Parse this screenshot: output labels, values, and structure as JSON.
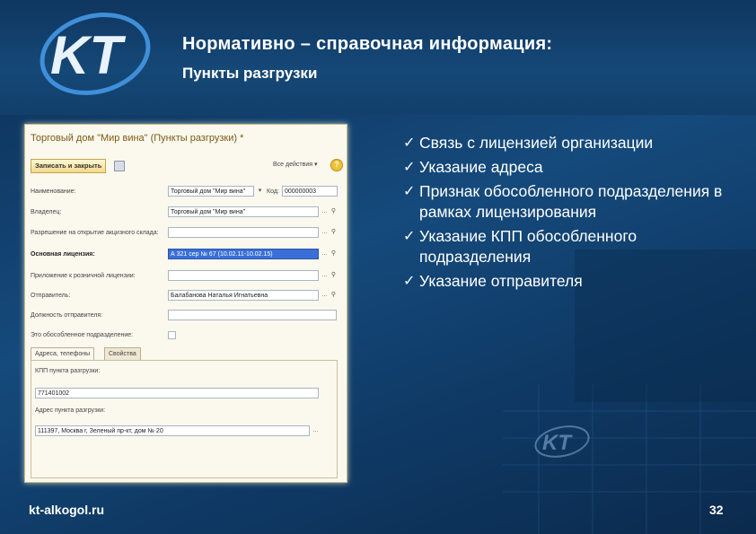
{
  "header": {
    "title": "Нормативно – справочная информация:",
    "subtitle": "Пункты разгрузки",
    "logo_text": "KT"
  },
  "form": {
    "window_title": "Торговый дом \"Мир вина\" (Пункты разгрузки) *",
    "save_button": "Записать и закрыть",
    "all_actions": "Все действия ▾",
    "help": "?",
    "fields": {
      "name_label": "Наименование:",
      "name_value": "Торговый дом \"Мир вина\"",
      "code_label": "Код:",
      "code_value": "000000003",
      "owner_label": "Владелец:",
      "owner_value": "Торговый дом \"Мир вина\"",
      "permit_label": "Разрешение на открытие акцизного склада:",
      "permit_value": "",
      "license_label": "Основная лицензия:",
      "license_value": "А 321 сер № 67 (10.02.11-10.02.15)",
      "retail_label": "Приложение к розничной лицензии:",
      "retail_value": "",
      "sender_label": "Отправитель:",
      "sender_value": "Балабанова Наталья Игнатьевна",
      "position_label": "Должность отправителя:",
      "position_value": "",
      "separate_label": "Это обособленное подразделение:"
    },
    "tabs": [
      "Адреса, телефоны",
      "Свойства"
    ],
    "tab_fields": {
      "kpp_label": "КПП пункта разгрузки:",
      "kpp_value": "771401002",
      "address_label": "Адрес пункта разгрузки:",
      "address_value": "111397, Москва г, Зеленый пр-кт, дом № 20"
    }
  },
  "bullets": [
    "Связь с лицензией организации",
    "Указание адреса",
    "Признак обособленного подразделения в рамках лицензирования",
    "Указание КПП обособленного подразделения",
    "Указание отправителя"
  ],
  "footer": {
    "site": "kt-alkogol.ru",
    "page": "32"
  },
  "colors": {
    "background": "#154a7c",
    "form_bg": "#fbf8ee",
    "selected": "#3a6fd8"
  }
}
